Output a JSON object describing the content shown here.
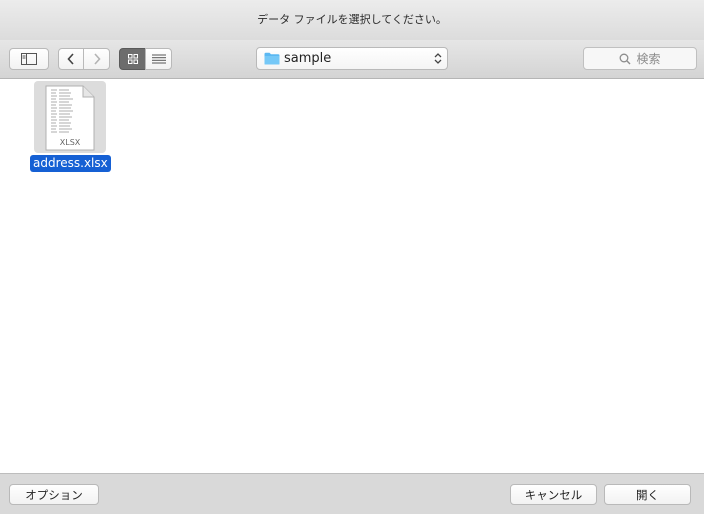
{
  "dialog": {
    "title": "データ ファイルを選択してください。"
  },
  "toolbar": {
    "location": "sample",
    "search_placeholder": "検索"
  },
  "files": [
    {
      "name": "address.xlsx",
      "type_label": "XLSX",
      "selected": true
    }
  ],
  "footer": {
    "options_label": "オプション",
    "cancel_label": "キャンセル",
    "open_label": "開く"
  },
  "colors": {
    "selection": "#1560d4",
    "folder": "#5bb8f2"
  }
}
